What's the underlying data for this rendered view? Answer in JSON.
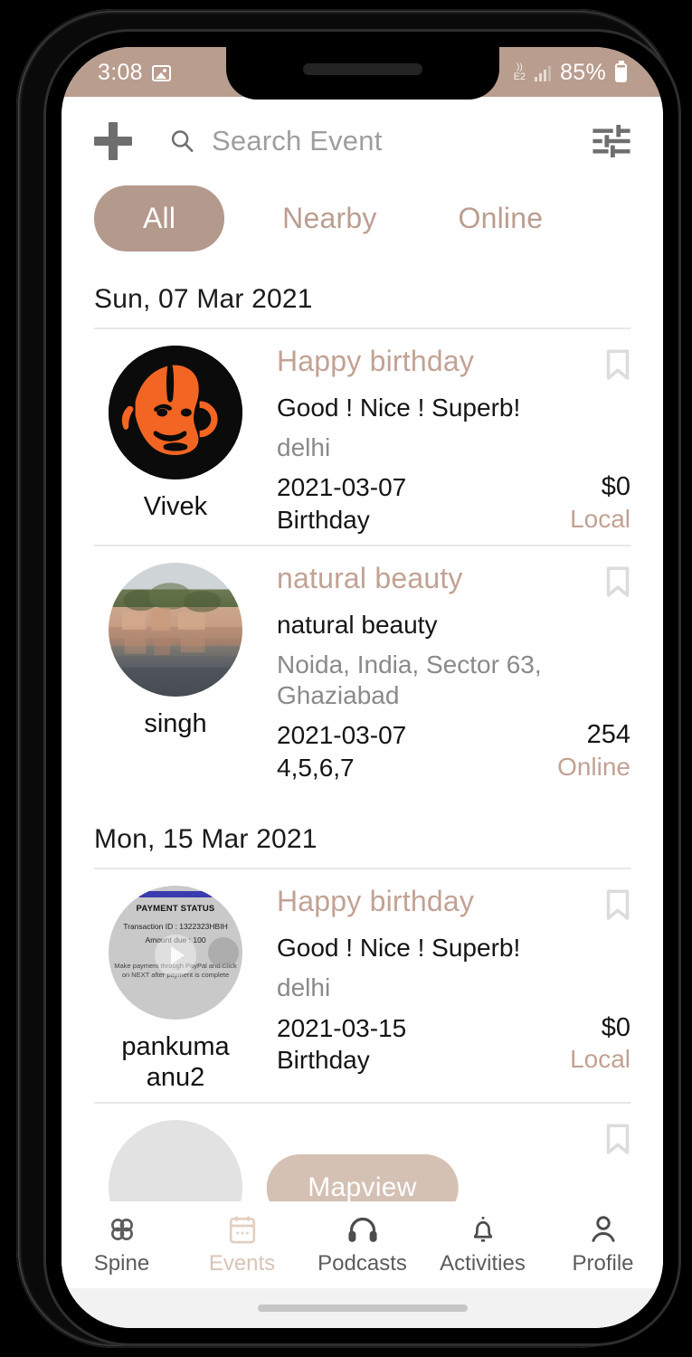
{
  "status_bar": {
    "time": "3:08",
    "battery_percent": "85%",
    "network_label": "E2",
    "icons": [
      "image-icon",
      "network-icon",
      "signal-bars-icon",
      "battery-icon"
    ],
    "background_color": "#b99d8e"
  },
  "topbar": {
    "add_label": "+",
    "search_placeholder": "Search Event",
    "icons": [
      "plus-icon",
      "search-icon",
      "filter-icon"
    ]
  },
  "tabs": [
    {
      "label": "All",
      "active": true
    },
    {
      "label": "Nearby",
      "active": false
    },
    {
      "label": "Online",
      "active": false
    }
  ],
  "sections": [
    {
      "date_header": "Sun, 07 Mar 2021",
      "events": [
        {
          "owner": "Vivek",
          "title": "Happy birthday",
          "description": "Good !  Nice !  Superb!",
          "location": "delhi",
          "date": "2021-03-07",
          "price": "$0",
          "category": "Birthday",
          "mode": "Local",
          "avatar": "hanuman-illustration"
        },
        {
          "owner": "singh",
          "title": "natural beauty",
          "description": "natural beauty",
          "location": "Noida, India, Sector 63, Ghaziabad",
          "date": "2021-03-07",
          "price": "254",
          "category": "4,5,6,7",
          "mode": "Online",
          "avatar": "landscape-photo"
        }
      ]
    },
    {
      "date_header": "Mon, 15 Mar 2021",
      "events": [
        {
          "owner": "pankuma anu2",
          "title": "Happy birthday",
          "description": "Good !  Nice !  Superb!",
          "location": "delhi",
          "date": "2021-03-15",
          "price": "$0",
          "category": "Birthday",
          "mode": "Local",
          "avatar": "payment-status-video",
          "avatar_text": {
            "heading": "PAYMENT STATUS",
            "transaction": "Transaction ID : 1322323HBIH",
            "amount": "Amount due   : 100",
            "note": "Make payment through PayPal and Click on NEXT after payment is complete"
          }
        }
      ]
    }
  ],
  "map_button": {
    "label": "Mapview",
    "color": "#d5c0b4"
  },
  "bottom_nav": [
    {
      "label": "Spine",
      "icon": "spine-clover-icon",
      "active": false
    },
    {
      "label": "Events",
      "icon": "calendar-icon",
      "active": true
    },
    {
      "label": "Podcasts",
      "icon": "headphones-icon",
      "active": false
    },
    {
      "label": "Activities",
      "icon": "bell-icon",
      "active": false
    },
    {
      "label": "Profile",
      "icon": "person-icon",
      "active": false
    }
  ],
  "theme": {
    "accent": "#b49a8c",
    "accent_light": "#c2a294",
    "fab": "#d5c0b4",
    "text": "#151515",
    "muted": "#8a8a8a"
  }
}
